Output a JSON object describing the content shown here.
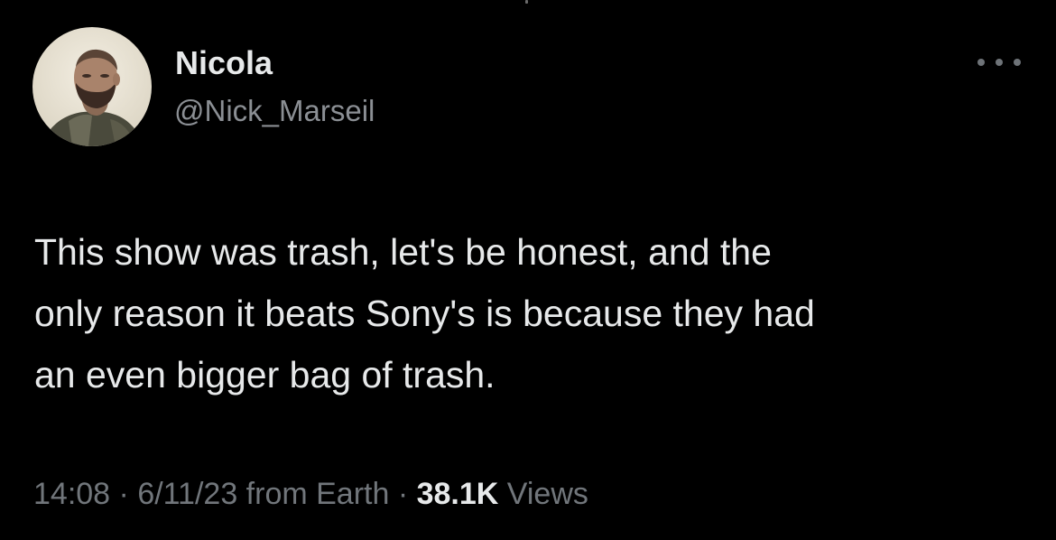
{
  "user": {
    "display_name": "Nicola",
    "handle": "@Nick_Marseil",
    "avatar_icon": "profile-photo-avatar"
  },
  "more_icon": "more-options-icon",
  "tweet": {
    "text_lines": [
      "This show was trash, let's be honest, and the",
      "only reason it beats Sony's is because they had",
      "an even bigger bag of trash."
    ]
  },
  "meta": {
    "time": "14:08",
    "separator": " · ",
    "date_source": "6/11/23 from Earth",
    "views_count": "38.1K",
    "views_label": " Views"
  },
  "colors": {
    "background": "#000000",
    "primary_text": "#e7e9ea",
    "secondary_text": "#71767b"
  }
}
